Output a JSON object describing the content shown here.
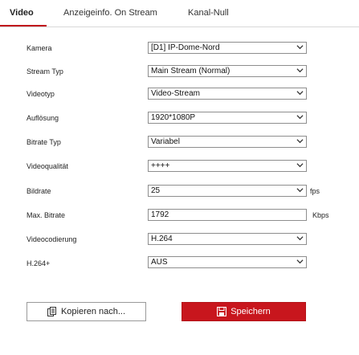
{
  "tabs": [
    {
      "label": "Video",
      "active": true
    },
    {
      "label": "Anzeigeinfo. On Stream",
      "active": false
    },
    {
      "label": "Kanal-Null",
      "active": false
    }
  ],
  "form": {
    "kamera": {
      "label": "Kamera",
      "value": "[D1] IP-Dome-Nord"
    },
    "stream_typ": {
      "label": "Stream Typ",
      "value": "Main Stream (Normal)"
    },
    "videotyp": {
      "label": "Videotyp",
      "value": "Video-Stream"
    },
    "aufloesung": {
      "label": "Auflösung",
      "value": "1920*1080P"
    },
    "bitrate_typ": {
      "label": "Bitrate Typ",
      "value": "Variabel"
    },
    "videoqualitaet": {
      "label": "Videoqualität",
      "value": "++++"
    },
    "bildrate": {
      "label": "Bildrate",
      "value": "25",
      "unit": "fps"
    },
    "max_bitrate": {
      "label": "Max. Bitrate",
      "value": "1792",
      "unit": "Kbps"
    },
    "videocodierung": {
      "label": "Videocodierung",
      "value": "H.264"
    },
    "h264plus": {
      "label": "H.264+",
      "value": "AUS"
    }
  },
  "buttons": {
    "copy_label": "Kopieren nach...",
    "save_label": "Speichern"
  },
  "colors": {
    "accent": "#c8161d",
    "field_border": "#8e8e8e",
    "chevron": "#333333"
  },
  "icons": {
    "chevron": "chevron-down-icon",
    "copy": "copy-icon",
    "save": "save-icon"
  }
}
